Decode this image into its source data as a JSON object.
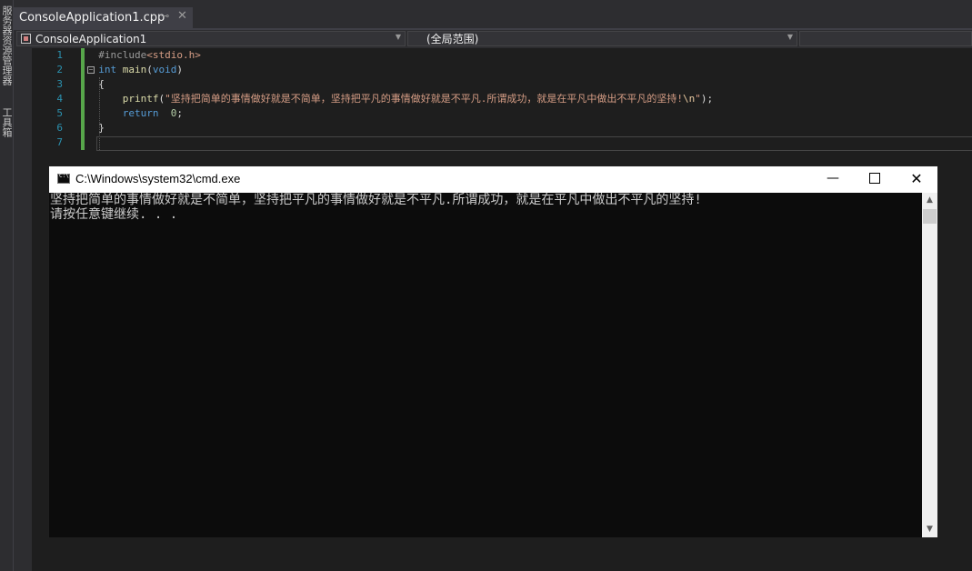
{
  "side_tabs": [
    "服务器资源管理器",
    "工具箱"
  ],
  "tab": {
    "label": "ConsoleApplication1.cpp"
  },
  "navbar": {
    "project": "ConsoleApplication1",
    "scope": "(全局范围)",
    "member": ""
  },
  "editor": {
    "line_numbers": [
      "1",
      "2",
      "3",
      "4",
      "5",
      "6",
      "7"
    ],
    "code": {
      "l1_directive": "#include",
      "l1_header": "<stdio.h>",
      "l2_kw": "int",
      "l2_fn": "main",
      "l2_paren_open": "(",
      "l2_void": "void",
      "l2_paren_close": ")",
      "l3": "{",
      "l4_fn": "printf",
      "l4_open": "(",
      "l4_string": "\"坚持把简单的事情做好就是不简单，坚持把平凡的事情做好就是不平凡.所谓成功，就是在平凡中做出不平凡的坚持!",
      "l4_escape": "\\n",
      "l4_string_end": "\"",
      "l4_close": ");",
      "l5_kw": "return",
      "l5_num": "0",
      "l5_semi": ";",
      "l6": "}"
    }
  },
  "console": {
    "title": "C:\\Windows\\system32\\cmd.exe",
    "output": [
      "坚持把简单的事情做好就是不简单，坚持把平凡的事情做好就是不平凡.所谓成功，就是在平凡中做出不平凡的坚持!",
      "请按任意键继续. . ."
    ]
  },
  "colors": {
    "ide_background": "#2d2d30",
    "editor_background": "#1e1e1e",
    "line_number": "#2b91af",
    "keyword": "#569cd6",
    "string": "#d69d85",
    "change_bar": "#57a64a",
    "console_background": "#0c0c0c"
  },
  "icons": [
    "project-icon",
    "pin-icon",
    "close-icon",
    "dropdown-arrow-icon",
    "cmd-icon",
    "minimize-icon",
    "maximize-icon",
    "scroll-up-icon",
    "scroll-down-icon"
  ]
}
